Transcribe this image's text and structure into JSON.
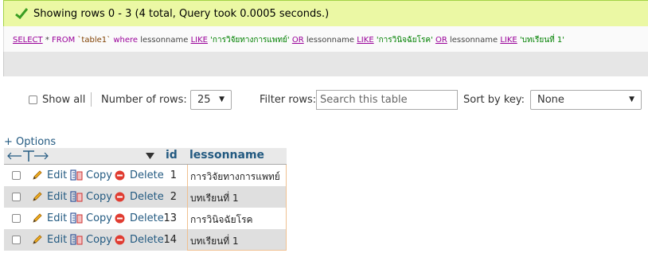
{
  "message": {
    "text": "Showing rows 0 - 3 (4 total, Query took 0.0005 seconds.)",
    "success_color": "#3a9d23"
  },
  "sql": {
    "select": "SELECT",
    "star": "*",
    "from": "FROM",
    "table": "`table1`",
    "where": "where",
    "column": "lessonname",
    "like": "LIKE",
    "or": "OR",
    "term1": "'การวิจัยทางการแพทย์'",
    "term2": "'การวินิจฉัยโรค'",
    "term3": "'บทเรียนที่ 1'"
  },
  "nav": {
    "show_all": "Show all",
    "number_of_rows_label": "Number of rows:",
    "number_of_rows_value": "25",
    "filter_rows_label": "Filter rows:",
    "filter_placeholder": "Search this table",
    "sort_by_key_label": "Sort by key:",
    "sort_by_key_value": "None"
  },
  "options_link": "+ Options",
  "table": {
    "columns": [
      "id",
      "lessonname"
    ],
    "actions": {
      "edit": "Edit",
      "copy": "Copy",
      "delete": "Delete"
    },
    "rows": [
      {
        "id": "1",
        "lessonname": "การวิจัยทางการแพทย์"
      },
      {
        "id": "2",
        "lessonname": "บทเรียนที่ 1"
      },
      {
        "id": "13",
        "lessonname": "การวินิจฉัยโรค"
      },
      {
        "id": "14",
        "lessonname": "บทเรียนที่ 1"
      }
    ]
  },
  "colors": {
    "success_bg": "#ebf8a4",
    "link": "#235a81",
    "keyword": "#990099",
    "row_alt": "#dfdfdf"
  }
}
